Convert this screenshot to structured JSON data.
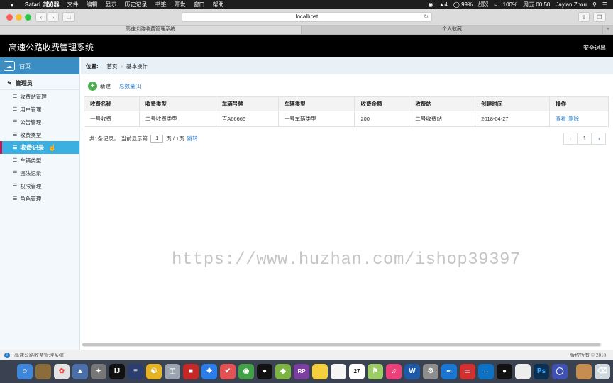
{
  "menubar": {
    "apple": "",
    "items": [
      "Safari 浏览器",
      "文件",
      "编辑",
      "显示",
      "历史记录",
      "书签",
      "开发",
      "窗口",
      "帮助"
    ],
    "battery": "99%",
    "percent": "100%",
    "clock": "周五 00:50",
    "user": "Jaylan Zhou",
    "net_up": "1.0K/s",
    "net_down": "0.5K/s",
    "badge_num": "4"
  },
  "browser": {
    "url": "localhost",
    "tabs": [
      "高速公路收费管理系统",
      "个人收藏"
    ],
    "new_tab": "+"
  },
  "app": {
    "title": "高速公路收费管理系统",
    "logout": "安全退出"
  },
  "sidebar": {
    "home": "首页",
    "group": "管理员",
    "items": [
      "收费站管理",
      "用户管理",
      "公告管理",
      "收费类型",
      "收费记录",
      "车辆类型",
      "违法记录",
      "权限管理",
      "角色管理"
    ]
  },
  "breadcrumb": {
    "label": "位置:",
    "home": "首页",
    "current": "基本操作"
  },
  "toolbar": {
    "add": "新建",
    "total": "总数量(1)"
  },
  "table": {
    "headers": [
      "收费名称",
      "收费类型",
      "车辆号牌",
      "车辆类型",
      "收费金额",
      "收费站",
      "创建时间",
      "操作"
    ],
    "rows": [
      {
        "name": "一号收费",
        "fee_type": "二号收费类型",
        "plate": "吉A66666",
        "vehicle_type": "一号车辆类型",
        "amount": "200",
        "station": "二号收费站",
        "created": "2018-04-27",
        "view": "查看",
        "delete": "删除"
      }
    ]
  },
  "pagination": {
    "summary_pre": "共1条记录，",
    "summary_mid": "当前显示第",
    "current_page": "1",
    "summary_post": "页 / 1页",
    "jump": "跳转",
    "prev": "‹",
    "page": "1",
    "next": "›"
  },
  "watermark": "https://www.huzhan.com/ishop39397",
  "statusbar": {
    "left": "高速公路收费管理系统",
    "right": "版权所有 © 2018"
  },
  "dock": {
    "rp_label": "RP",
    "ps_label": "Ps",
    "calendar_day": "27",
    "word_label": "W"
  },
  "colors": {
    "header_bg": "#000000",
    "sidebar_home": "#3b8ec4",
    "sidebar_active": "#3ab0e2",
    "link": "#2a7bc7",
    "add_icon": "#4caf50"
  }
}
